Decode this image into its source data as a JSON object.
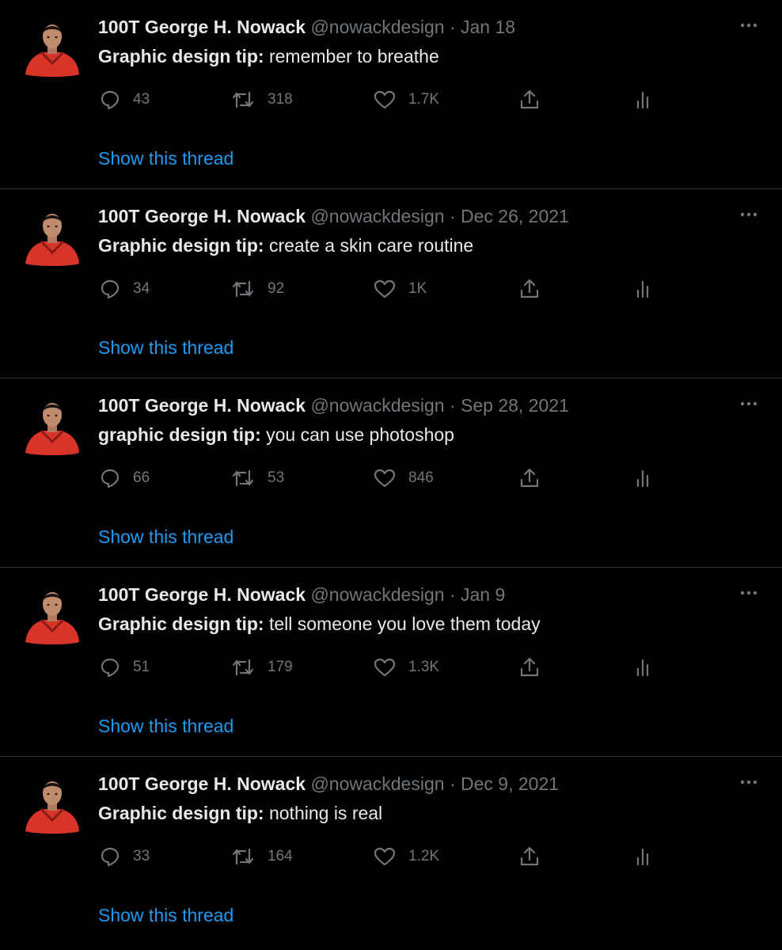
{
  "colors": {
    "background": "#000000",
    "text": "#e7e9ea",
    "muted": "#71767b",
    "link": "#1d9bf0",
    "divider": "#2f3336",
    "avatar_jacket": "#d8342a"
  },
  "icons": {
    "reply": "reply-icon",
    "retweet": "retweet-icon",
    "like": "heart-icon",
    "share": "share-icon",
    "stats": "stats-icon",
    "more": "more-icon"
  },
  "tweets": [
    {
      "author_name": "100T George H. Nowack",
      "handle": "@nowackdesign",
      "separator": "·",
      "date": "Jan 18",
      "text_lead": "Graphic design tip:",
      "text_rest": " remember to breathe",
      "replies": "43",
      "retweets": "318",
      "likes": "1.7K",
      "show_thread": "Show this thread"
    },
    {
      "author_name": "100T George H. Nowack",
      "handle": "@nowackdesign",
      "separator": "·",
      "date": "Dec 26, 2021",
      "text_lead": "Graphic design tip:",
      "text_rest": " create a skin care routine",
      "replies": "34",
      "retweets": "92",
      "likes": "1K",
      "show_thread": "Show this thread"
    },
    {
      "author_name": "100T George H. Nowack",
      "handle": "@nowackdesign",
      "separator": "·",
      "date": "Sep 28, 2021",
      "text_lead": "graphic design tip:",
      "text_rest": " you can use photoshop",
      "replies": "66",
      "retweets": "53",
      "likes": "846",
      "show_thread": "Show this thread"
    },
    {
      "author_name": "100T George H. Nowack",
      "handle": "@nowackdesign",
      "separator": "·",
      "date": "Jan 9",
      "text_lead": "Graphic design tip:",
      "text_rest": " tell someone you love them today",
      "replies": "51",
      "retweets": "179",
      "likes": "1.3K",
      "show_thread": "Show this thread"
    },
    {
      "author_name": "100T George H. Nowack",
      "handle": "@nowackdesign",
      "separator": "·",
      "date": "Dec 9, 2021",
      "text_lead": "Graphic design tip:",
      "text_rest": " nothing is real",
      "replies": "33",
      "retweets": "164",
      "likes": "1.2K",
      "show_thread": "Show this thread"
    }
  ]
}
